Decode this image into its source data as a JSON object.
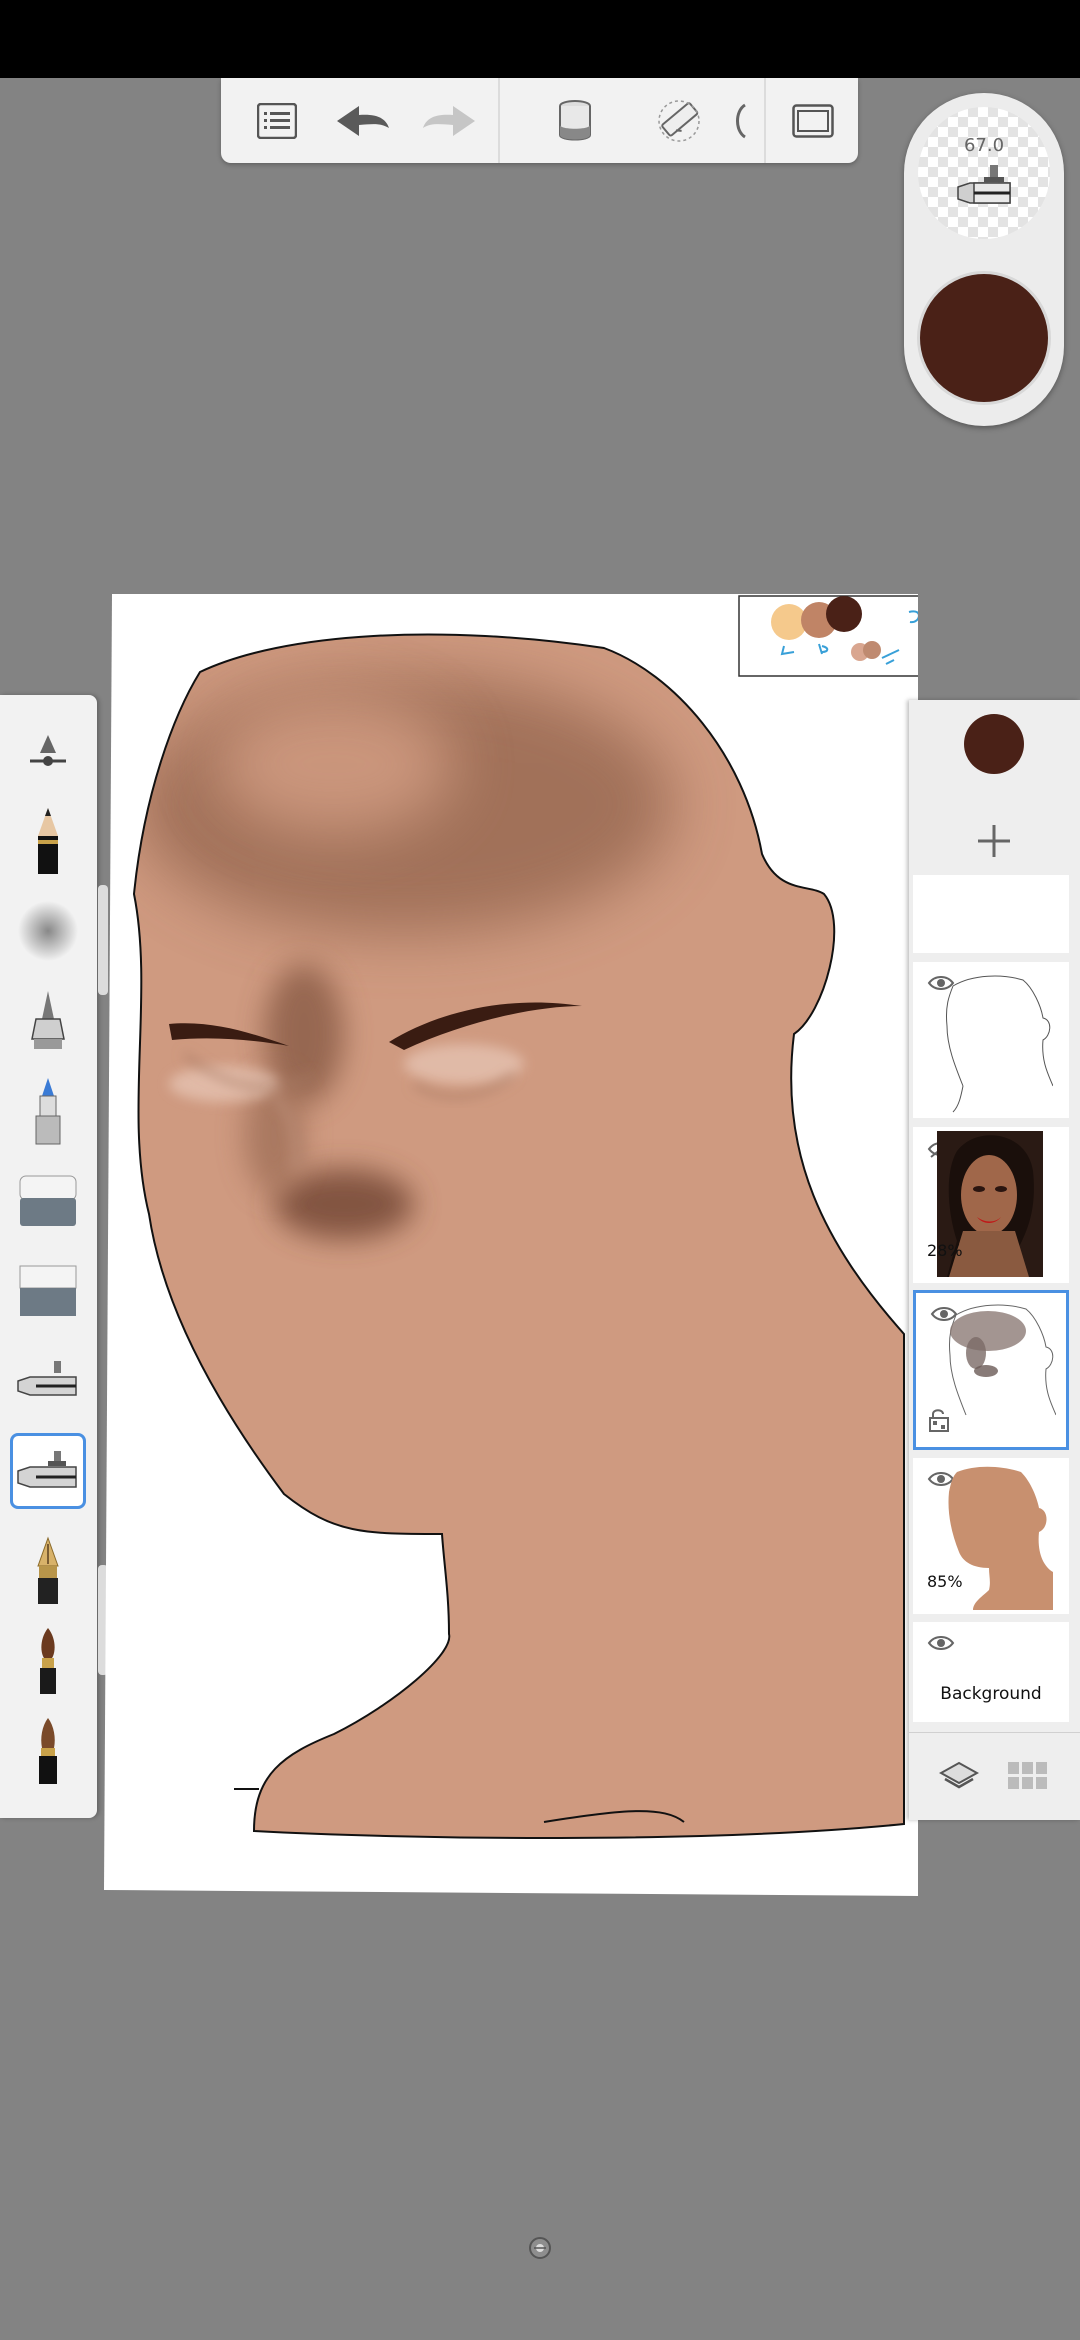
{
  "app": {
    "colors": {
      "background": "#838383",
      "skin": "#cf9a80",
      "current_color": "#4a2117",
      "selection": "#4a90e2"
    }
  },
  "toolbar": {
    "buttons": [
      "list-icon",
      "undo-icon",
      "redo-icon",
      "fill-bucket-icon",
      "ruler-icon",
      "symmetry-icon",
      "fullscreen-icon"
    ]
  },
  "puck": {
    "brush_size": "67.0",
    "color": "#4a2117"
  },
  "brushes": {
    "items": [
      "brush-settings-icon",
      "pencil-icon",
      "soft-airbrush-icon",
      "airbrush-icon",
      "marker-icon",
      "soft-eraser-icon",
      "hard-eraser-icon",
      "airbrush-small-icon",
      "airbrush-selected-icon",
      "fountain-pen-icon",
      "paintbrush-icon",
      "ink-brush-icon"
    ],
    "selected": "airbrush-selected-icon"
  },
  "layers": {
    "items": [
      {
        "id": "blank",
        "opacity_label": "",
        "name": ""
      },
      {
        "id": "sketch",
        "opacity_label": "",
        "name": ""
      },
      {
        "id": "reference-photo",
        "opacity_label": "28%",
        "name": ""
      },
      {
        "id": "shading",
        "opacity_label": "",
        "name": ""
      },
      {
        "id": "skin-base",
        "opacity_label": "85%",
        "name": ""
      },
      {
        "id": "background",
        "opacity_label": "",
        "name": "Background"
      }
    ],
    "selected": "shading"
  }
}
